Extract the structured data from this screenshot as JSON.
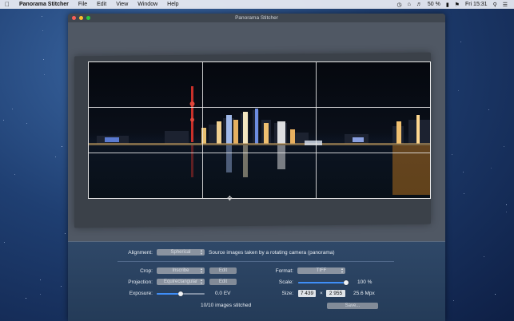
{
  "menubar": {
    "app_name": "Panorama Stitcher",
    "items": [
      "File",
      "Edit",
      "View",
      "Window",
      "Help"
    ],
    "battery": "50 %",
    "clock": "Fri 15:31"
  },
  "window": {
    "title": "Panorama Stitcher"
  },
  "controls": {
    "alignment": {
      "label": "Alignment:",
      "value": "Spherical",
      "note": "Source images taken by a rotating camera (panorama)"
    },
    "crop": {
      "label": "Crop:",
      "value": "Inscribe",
      "edit_label": "Edit"
    },
    "projection": {
      "label": "Projection:",
      "value": "Equirectangular",
      "edit_label": "Edit"
    },
    "exposure": {
      "label": "Exposure:",
      "value": "0.0 EV",
      "level": 0.5
    },
    "status": "10/10 images stitched",
    "format": {
      "label": "Format:",
      "value": "TIFF"
    },
    "scale": {
      "label": "Scale:",
      "value": "100 %",
      "level": 1.0
    },
    "size": {
      "label": "Size:",
      "width": "7 439",
      "times": "×",
      "height": "2 955",
      "mpx": "25.6 Mpx"
    },
    "save_label": "Save..."
  },
  "colors": {
    "accent": "#3f8ef7",
    "panel_bg": "#2a4262",
    "close": "#fc5f57",
    "minimize": "#fdbc2e",
    "zoom": "#28c840"
  }
}
